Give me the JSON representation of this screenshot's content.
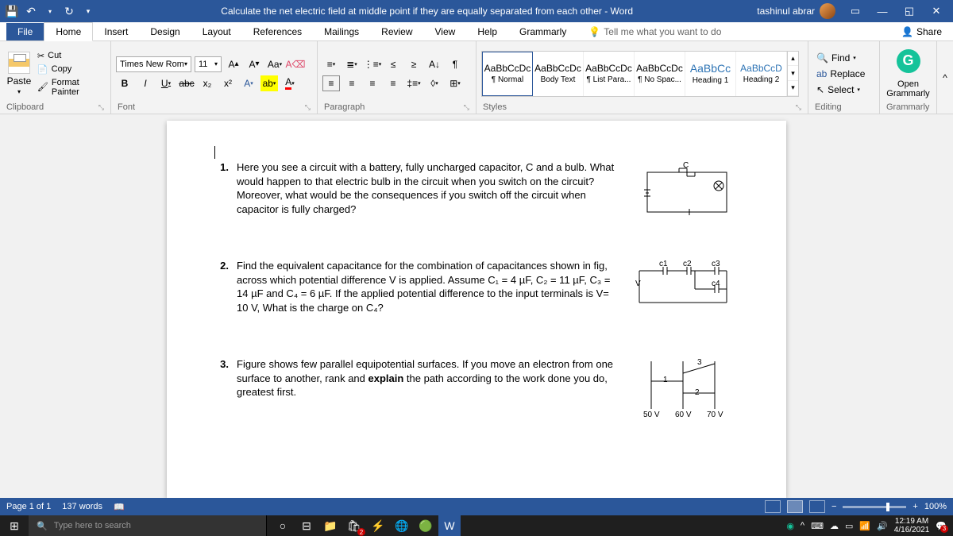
{
  "title": "Calculate the net electric field at middle point if they are equally separated from each other  -  Word",
  "user": "tashinul abrar",
  "tabs": {
    "file": "File",
    "home": "Home",
    "insert": "Insert",
    "design": "Design",
    "layout": "Layout",
    "references": "References",
    "mailings": "Mailings",
    "review": "Review",
    "view": "View",
    "help": "Help",
    "grammarly": "Grammarly",
    "tellme": "Tell me what you want to do",
    "share": "Share"
  },
  "clipboard": {
    "cut": "Cut",
    "copy": "Copy",
    "fp": "Format Painter",
    "paste": "Paste",
    "label": "Clipboard"
  },
  "font": {
    "name": "Times New Rom",
    "size": "11",
    "label": "Font"
  },
  "paragraph": {
    "label": "Paragraph"
  },
  "styles": {
    "items": [
      {
        "preview": "AaBbCcDc",
        "name": "¶ Normal"
      },
      {
        "preview": "AaBbCcDc",
        "name": "Body Text"
      },
      {
        "preview": "AaBbCcDc",
        "name": "¶ List Para..."
      },
      {
        "preview": "AaBbCcDc",
        "name": "¶ No Spac..."
      },
      {
        "preview": "AaBbCc",
        "name": "Heading 1"
      },
      {
        "preview": "AaBbCcD",
        "name": "Heading 2"
      }
    ],
    "label": "Styles"
  },
  "editing": {
    "find": "Find",
    "replace": "Replace",
    "select": "Select",
    "label": "Editing"
  },
  "grammarly_group": {
    "open": "Open\nGrammarly",
    "label": "Grammarly"
  },
  "doc": {
    "q1_num": "1.",
    "q1": "Here you see a circuit with a battery, fully uncharged capacitor, C and a bulb. What would happen to that electric bulb in the circuit when you switch on the circuit? Moreover, what would be the consequences if you switch off the circuit when capacitor is fully charged?",
    "q1_label": "C",
    "q2_num": "2.",
    "q2_p1": "Find the equivalent capacitance for the combination of capacitances shown in fig, across which potential difference V is applied. Assume C₁ = 4 ",
    "q2_u1": "µF",
    "q2_p2": ", C₂ = 11 ",
    "q2_u2": "µF",
    "q2_p3": ", C₃ = 14 ",
    "q2_u3": "µF",
    "q2_p4": " and C₄ = 6 ",
    "q2_u4": "µF",
    "q2_p5": ". If the applied potential difference to the input terminals is V= 10 V, ",
    "q2_b": "What",
    "q2_p6": " is the charge on C₄?",
    "q2_labels": {
      "V": "V",
      "c1": "c1",
      "c2": "c2",
      "c3": "c3",
      "c4": "c4"
    },
    "q3_num": "3.",
    "q3": "Figure shows few parallel equipotential surfaces. If you move an electron from one surface to another, rank and ",
    "q3_b": "explain",
    "q3_p2": " the path according to the work done you do, greatest first.",
    "q3_labels": {
      "l1": "1",
      "l2": "2",
      "l3": "3",
      "v1": "50 V",
      "v2": "60 V",
      "v3": "70 V"
    }
  },
  "status": {
    "page": "Page 1 of 1",
    "words": "137 words",
    "zoom": "100%"
  },
  "taskbar": {
    "search": "Type here to search",
    "time": "12:19 AM",
    "date": "4/16/2021",
    "notif": "3",
    "badge": "2"
  }
}
